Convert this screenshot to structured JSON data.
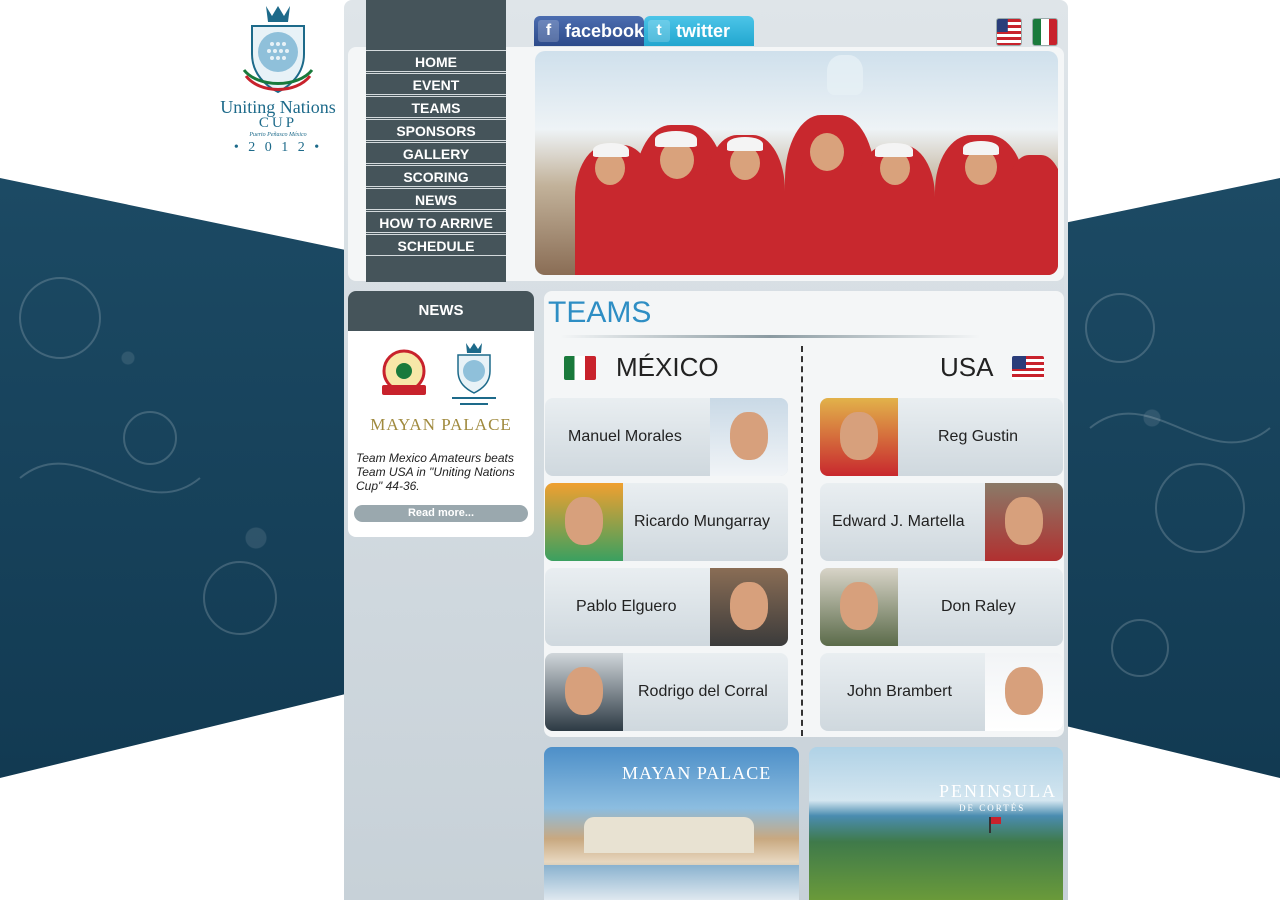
{
  "logo": {
    "line1": "Uniting Nations",
    "line2": "CUP",
    "line3": "Puerto Peñasco México",
    "year": "• 2 0 1 2 •"
  },
  "nav": [
    {
      "label": "HOME"
    },
    {
      "label": "EVENT"
    },
    {
      "label": "TEAMS"
    },
    {
      "label": "SPONSORS"
    },
    {
      "label": "GALLERY"
    },
    {
      "label": "SCORING"
    },
    {
      "label": "NEWS"
    },
    {
      "label": "HOW TO ARRIVE"
    },
    {
      "label": "SCHEDULE"
    }
  ],
  "social": {
    "facebook": "facebook",
    "twitter": "twitter"
  },
  "news": {
    "title": "NEWS",
    "sponsor": "MAYAN PALACE",
    "text": "Team Mexico Amateurs beats Team USA in \"Uniting Nations Cup\" 44-36.",
    "read_more": "Read more..."
  },
  "teams": {
    "title": "TEAMS",
    "mexico": {
      "label": "MÉXICO",
      "players": [
        "Manuel Morales",
        "Ricardo Mungarray",
        "Pablo Elguero",
        "Rodrigo del Corral"
      ]
    },
    "usa": {
      "label": "USA",
      "players": [
        "Reg Gustin",
        "Edward J. Martella",
        "Don Raley",
        "John Brambert"
      ]
    }
  },
  "promos": {
    "mayan": "MAYAN PALACE",
    "peninsula": "PENINSULA",
    "peninsula_sub": "DE CORTÉS"
  },
  "colors": {
    "nav_bg": "#45545a",
    "accent_blue": "#2e8ec4",
    "wave_bg": "#1c4a64"
  }
}
